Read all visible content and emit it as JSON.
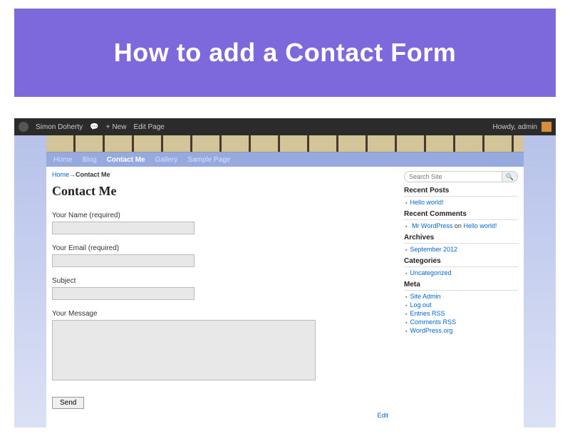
{
  "banner": {
    "title": "How to add a Contact Form"
  },
  "admin_bar": {
    "site_name": "Simon Doherty",
    "new_label": "New",
    "edit_label": "Edit Page",
    "greeting": "Howdy, admin"
  },
  "nav": {
    "items": [
      "Home",
      "Blog",
      "Contact Me",
      "Gallery",
      "Sample Page"
    ],
    "active_index": 2
  },
  "breadcrumb": {
    "home": "Home",
    "sep": "→",
    "current": "Contact Me"
  },
  "page": {
    "title": "Contact Me"
  },
  "form": {
    "name_label": "Your Name (required)",
    "email_label": "Your Email (required)",
    "subject_label": "Subject",
    "message_label": "Your Message",
    "send_label": "Send"
  },
  "sidebar": {
    "search_placeholder": "Search Site",
    "widgets": {
      "recent_posts": {
        "title": "Recent Posts",
        "items": [
          "Hello world!"
        ]
      },
      "recent_comments": {
        "title": "Recent Comments",
        "author": "Mr WordPress",
        "on": "on",
        "post": "Hello world!"
      },
      "archives": {
        "title": "Archives",
        "items": [
          "September 2012"
        ]
      },
      "categories": {
        "title": "Categories",
        "items": [
          "Uncategorized"
        ]
      },
      "meta": {
        "title": "Meta",
        "items": [
          "Site Admin",
          "Log out",
          "Entries RSS",
          "Comments RSS",
          "WordPress.org"
        ]
      }
    }
  },
  "edit_label": "Edit"
}
